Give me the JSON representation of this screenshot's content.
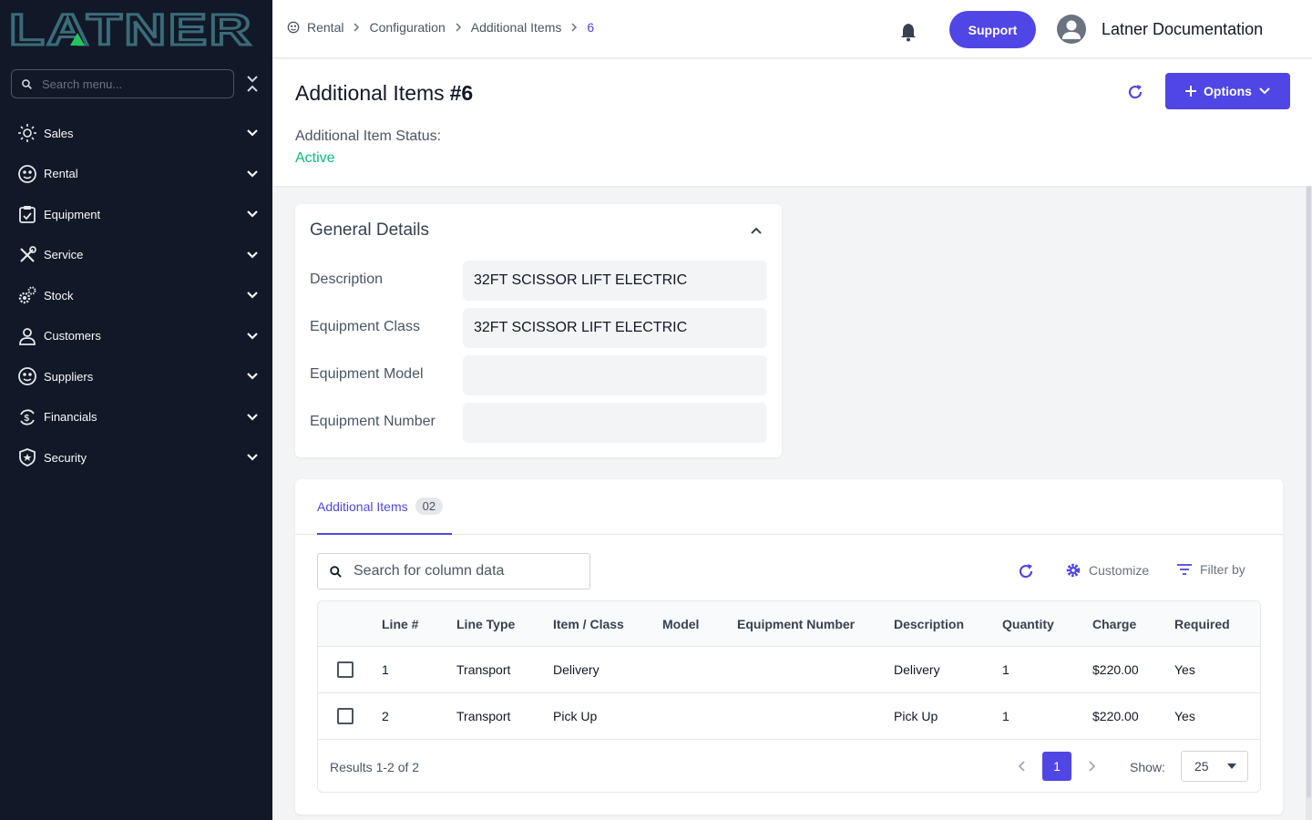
{
  "brand": {
    "logo_text": "LATNER",
    "accent": "#4f46e5",
    "sidebar_bg": "#111827",
    "status_color": "#10b981"
  },
  "sidebar": {
    "search_placeholder": "Search menu...",
    "items": [
      {
        "label": "Sales",
        "icon": "sales-sun-icon"
      },
      {
        "label": "Rental",
        "icon": "rental-face-icon"
      },
      {
        "label": "Equipment",
        "icon": "clipboard-icon"
      },
      {
        "label": "Service",
        "icon": "tools-icon"
      },
      {
        "label": "Stock",
        "icon": "gears-icon"
      },
      {
        "label": "Customers",
        "icon": "user-icon"
      },
      {
        "label": "Suppliers",
        "icon": "supplier-face-icon"
      },
      {
        "label": "Financials",
        "icon": "currency-icon"
      },
      {
        "label": "Security",
        "icon": "shield-icon"
      }
    ]
  },
  "topbar": {
    "breadcrumb": [
      "Rental",
      "Configuration",
      "Additional Items",
      "6"
    ],
    "support_label": "Support",
    "user_name": "Latner Documentation"
  },
  "page": {
    "title": "Additional Items",
    "number": "#6",
    "options_label": "Options",
    "status_label": "Additional Item Status:",
    "status_value": "Active"
  },
  "general_details": {
    "title": "General Details",
    "fields": [
      {
        "label": "Description",
        "value": "32FT SCISSOR LIFT ELECTRIC"
      },
      {
        "label": "Equipment Class",
        "value": "32FT SCISSOR LIFT ELECTRIC"
      },
      {
        "label": "Equipment Model",
        "value": ""
      },
      {
        "label": "Equipment Number",
        "value": ""
      }
    ]
  },
  "items_tab": {
    "label": "Additional Items",
    "count": "02",
    "search_placeholder": "Search for column data",
    "customize_label": "Customize",
    "filter_label": "Filter by",
    "columns": [
      "Line #",
      "Line Type",
      "Item / Class",
      "Model",
      "Equipment Number",
      "Description",
      "Quantity",
      "Charge",
      "Required"
    ],
    "rows": [
      [
        "1",
        "Transport",
        "Delivery",
        "",
        "",
        "Delivery",
        "1",
        "$220.00",
        "Yes"
      ],
      [
        "2",
        "Transport",
        "Pick Up",
        "",
        "",
        "Pick Up",
        "1",
        "$220.00",
        "Yes"
      ]
    ],
    "results_text": "Results 1-2 of 2",
    "current_page": "1",
    "show_label": "Show:",
    "page_size": "25"
  }
}
